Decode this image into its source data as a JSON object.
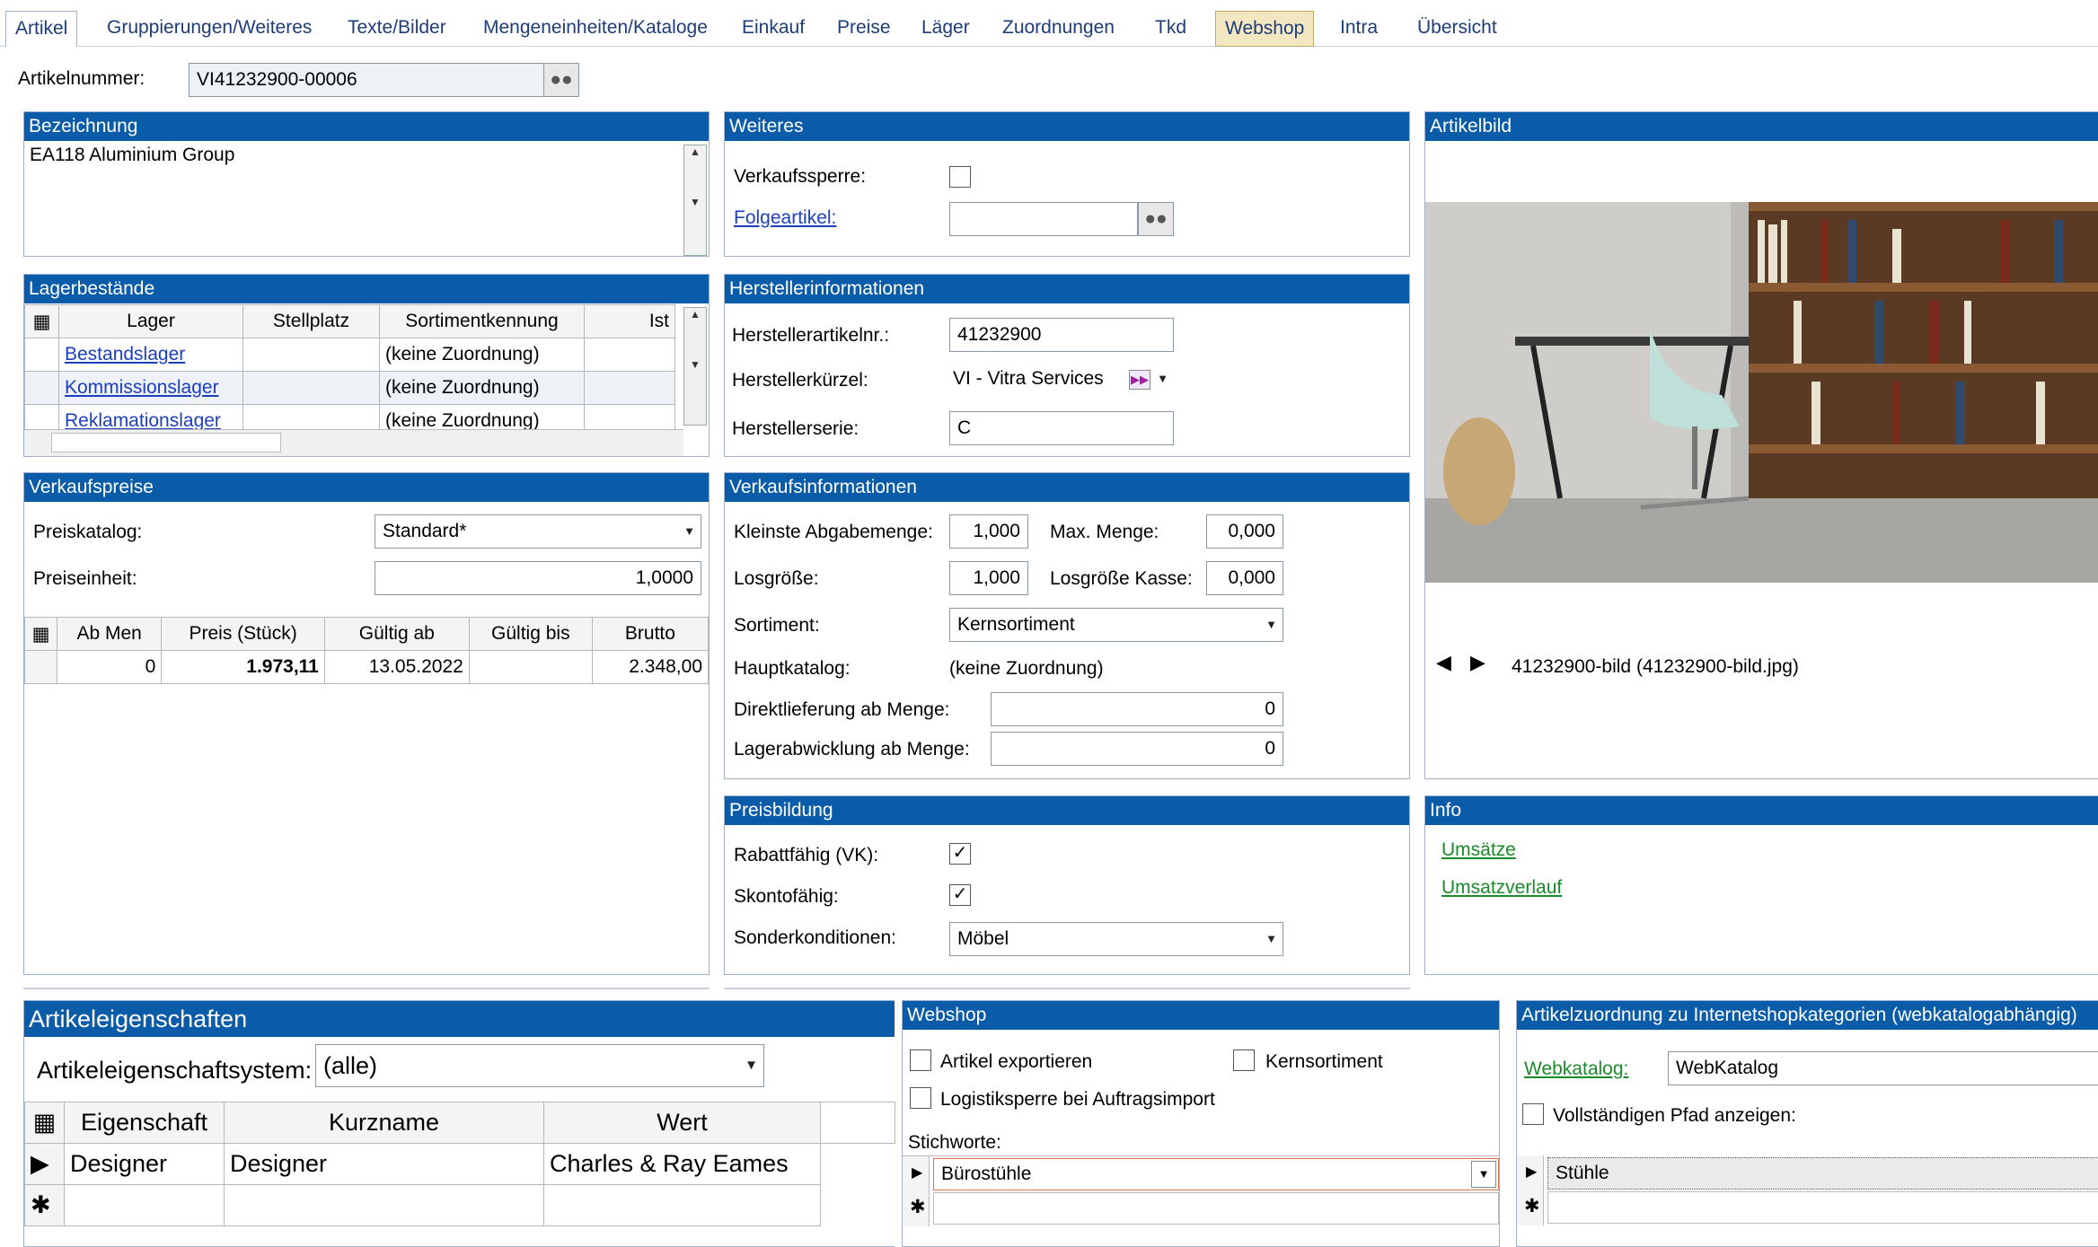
{
  "tabs": [
    "Artikel",
    "Gruppierungen/Weiteres",
    "Texte/Bilder",
    "Mengeneinheiten/Kataloge",
    "Einkauf",
    "Preise",
    "Läger",
    "Zuordnungen",
    "Tkd",
    "Webshop",
    "Intra",
    "Übersicht"
  ],
  "artikel": {
    "label": "Artikelnummer:",
    "value": "VI41232900-00006"
  },
  "bezeichnung": {
    "title": "Bezeichnung",
    "text": "EA118 Aluminium Group"
  },
  "lager": {
    "title": "Lagerbestände",
    "columns": [
      "Lager",
      "Stellplatz",
      "Sortimentkennung",
      "Ist"
    ],
    "rows": [
      {
        "name": "Bestandslager",
        "sort": "(keine Zuordnung)"
      },
      {
        "name": "Kommissionslager",
        "sort": "(keine Zuordnung)"
      },
      {
        "name": "Reklamationslager",
        "sort": "(keine Zuordnung)"
      }
    ]
  },
  "vk": {
    "title": "Verkaufspreise",
    "katalog_label": "Preiskatalog:",
    "katalog_value": "Standard*",
    "einheit_label": "Preiseinheit:",
    "einheit_value": "1,0000",
    "columns": [
      "Ab Men",
      "Preis (Stück)",
      "Gültig ab",
      "Gültig bis",
      "Brutto"
    ],
    "row": {
      "ab": "0",
      "preis": "1.973,11",
      "von": "13.05.2022",
      "bis": "",
      "brutto": "2.348,00"
    }
  },
  "weiteres": {
    "title": "Weiteres",
    "sperre": "Verkaufssperre:",
    "folge": "Folgeartikel:"
  },
  "hersteller": {
    "title": "Herstellerinformationen",
    "nr_label": "Herstellerartikelnr.:",
    "nr": "41232900",
    "kurz_label": "Herstellerkürzel:",
    "kurz": "VI - Vitra Services",
    "serie_label": "Herstellerserie:",
    "serie": "C"
  },
  "vki": {
    "title": "Verkaufsinformationen",
    "kl_label": "Kleinste Abgabemenge:",
    "kl": "1,000",
    "max_label": "Max. Menge:",
    "max": "0,000",
    "los_label": "Losgröße:",
    "los": "1,000",
    "losk_label": "Losgröße Kasse:",
    "losk": "0,000",
    "sort_label": "Sortiment:",
    "sort": "Kernsortiment",
    "haupt_label": "Hauptkatalog:",
    "haupt": "(keine Zuordnung)",
    "direkt_label": "Direktlieferung ab Menge:",
    "direkt": "0",
    "lagerab_label": "Lagerabwicklung ab Menge:",
    "lagerab": "0"
  },
  "preisbildung": {
    "title": "Preisbildung",
    "rabatt": "Rabattfähig (VK):",
    "skonto": "Skontofähig:",
    "sonder_label": "Sonderkonditionen:",
    "sonder": "Möbel"
  },
  "bild": {
    "title": "Artikelbild",
    "caption": "41232900-bild (41232900-bild.jpg)"
  },
  "info": {
    "title": "Info",
    "l1": "Umsätze",
    "l2": "Umsatzverlauf"
  },
  "eigen": {
    "title": "Artikeleigenschaften",
    "sys_label": "Artikeleigenschaftsystem:",
    "sys": "(alle)",
    "columns": [
      "Eigenschaft",
      "Kurzname",
      "Wert"
    ],
    "row": {
      "e": "Designer",
      "k": "Designer",
      "w": "Charles & Ray Eames"
    }
  },
  "webshop": {
    "title": "Webshop",
    "export": "Artikel exportieren",
    "kern": "Kernsortiment",
    "logistik": "Logistiksperre bei Auftragsimport",
    "stich_label": "Stichworte:",
    "stich": "Bürostühle"
  },
  "zuord": {
    "title": "Artikelzuordnung zu Internetshopkategorien (webkatalogabhängig)",
    "web_label": "Webkatalog:",
    "web": "WebKatalog",
    "pfad": "Vollständigen Pfad anzeigen:",
    "kat": "Stühle"
  }
}
